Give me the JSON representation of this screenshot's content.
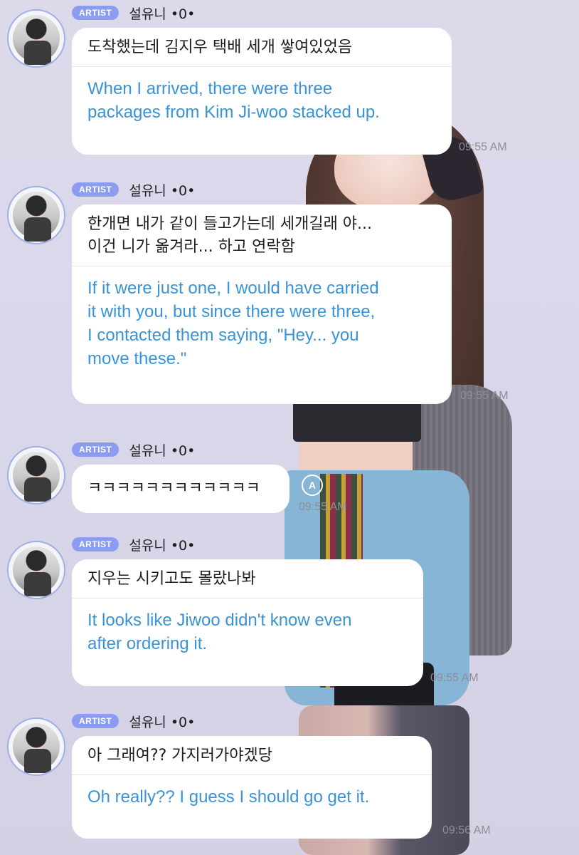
{
  "chat": {
    "artist_badge": "ARTIST",
    "messages": [
      {
        "nickname": "설유니 •0•",
        "korean": "도착했는데 김지우 택배 세개 쌓여있었음",
        "english": "When I arrived, there were three\npackages from Kim Ji-woo stacked up.",
        "time": "09:55 AM"
      },
      {
        "nickname": "설유니 •0•",
        "korean": "한개면 내가 같이 들고가는데 세개길래 야...\n이건 니가 옮겨라... 하고 연락함",
        "english": "If it were just one, I would have carried\nit with you, but since there were three,\nI contacted them saying, \"Hey... you\nmove these.\"",
        "time": "09:55 AM"
      },
      {
        "nickname": "설유니 •0•",
        "korean": "ㅋㅋㅋㅋㅋㅋㅋㅋㅋㅋㅋㅋ",
        "english": "",
        "time": "09:55 AM",
        "translate_icon": "A"
      },
      {
        "nickname": "설유니 •0•",
        "korean": "지우는 시키고도 몰랐나봐",
        "english": "It looks like Jiwoo didn't know even\nafter ordering it.",
        "time": "09:55 AM"
      },
      {
        "nickname": "설유니 •0•",
        "korean": "아 그래여?? 가지러가야겠당",
        "english": "Oh really?? I guess I should go get it.",
        "time": "09:56 AM"
      }
    ]
  }
}
